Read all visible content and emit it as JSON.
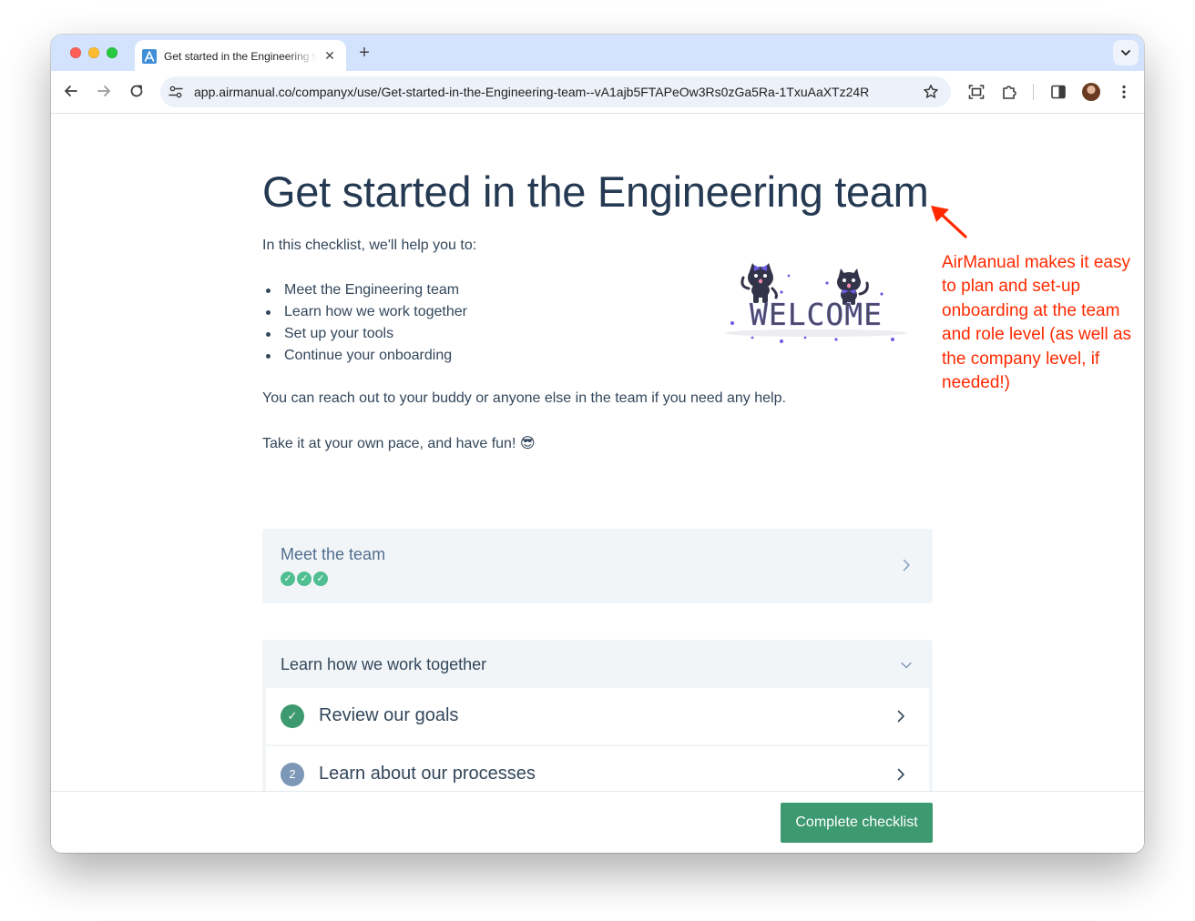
{
  "browser": {
    "tab_title": "Get started in the Engineering team",
    "tab_close_glyph": "✕",
    "new_tab_glyph": "+",
    "url": "app.airmanual.co/companyx/use/Get-started-in-the-Engineering-team--vA1ajb5FTAPeOw3Rs0zGa5Ra-1TxuAaXTz24R"
  },
  "page": {
    "title": "Get started in the Engineering team",
    "intro": "In this checklist, we'll help you to:",
    "bullets": [
      "Meet the Engineering team",
      "Learn how we work together",
      "Set up your tools",
      "Continue your onboarding"
    ],
    "help_text": "You can reach out to your buddy or anyone else in the team if you need any help.",
    "closing": "Take it at your own pace, and have fun! 😎",
    "welcome_image_text": "WELCOME"
  },
  "sections": [
    {
      "title": "Meet the team",
      "state": "collapsed",
      "progress_checks": [
        "✓",
        "✓",
        "✓"
      ]
    },
    {
      "title": "Learn how we work together",
      "state": "expanded",
      "items": [
        {
          "label": "Review our goals",
          "status": "completed",
          "badge": "✓"
        },
        {
          "label": "Learn about our processes",
          "status": "pending",
          "badge": "2"
        }
      ]
    }
  ],
  "footer": {
    "complete_label": "Complete checklist"
  },
  "annotation": {
    "text": "AirManual makes it easy to plan and set-up onboarding at the team and role level (as well as the company level, if needed!)"
  },
  "colors": {
    "tab_strip": "#d3e3fd",
    "heading": "#253a52",
    "body_text": "#33475b",
    "section_bg": "#f2f5f8",
    "check_green": "#4fbf92",
    "completed_badge": "#3d9970",
    "pending_badge": "#7c98b6",
    "primary_button": "#3d9970",
    "annotation_red": "#ff2a00",
    "welcome_purple": "#6c5ce7"
  },
  "icons": {
    "back": "arrow-left-icon",
    "forward": "arrow-right-icon",
    "reload": "reload-icon",
    "site_settings": "tune-icon",
    "bookmark": "star-icon",
    "screenshot": "screen-capture-icon",
    "extensions": "puzzle-icon",
    "side_panel": "side-panel-icon",
    "menu": "kebab-menu-icon"
  }
}
